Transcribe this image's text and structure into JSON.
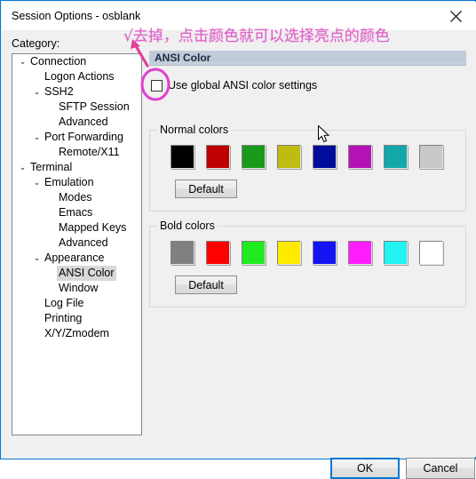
{
  "window": {
    "title": "Session Options - osblank",
    "close_icon": "close-icon"
  },
  "sidebar": {
    "label": "Category:",
    "items": [
      {
        "label": "Connection",
        "indent": 0,
        "chevron": "⌄",
        "selected": false
      },
      {
        "label": "Logon Actions",
        "indent": 1,
        "chevron": "",
        "selected": false
      },
      {
        "label": "SSH2",
        "indent": 1,
        "chevron": "⌄",
        "selected": false
      },
      {
        "label": "SFTP Session",
        "indent": 2,
        "chevron": "",
        "selected": false
      },
      {
        "label": "Advanced",
        "indent": 2,
        "chevron": "",
        "selected": false
      },
      {
        "label": "Port Forwarding",
        "indent": 1,
        "chevron": "⌄",
        "selected": false
      },
      {
        "label": "Remote/X11",
        "indent": 2,
        "chevron": "",
        "selected": false
      },
      {
        "label": "Terminal",
        "indent": 0,
        "chevron": "⌄",
        "selected": false
      },
      {
        "label": "Emulation",
        "indent": 1,
        "chevron": "⌄",
        "selected": false
      },
      {
        "label": "Modes",
        "indent": 2,
        "chevron": "",
        "selected": false
      },
      {
        "label": "Emacs",
        "indent": 2,
        "chevron": "",
        "selected": false
      },
      {
        "label": "Mapped Keys",
        "indent": 2,
        "chevron": "",
        "selected": false
      },
      {
        "label": "Advanced",
        "indent": 2,
        "chevron": "",
        "selected": false
      },
      {
        "label": "Appearance",
        "indent": 1,
        "chevron": "⌄",
        "selected": false
      },
      {
        "label": "ANSI Color",
        "indent": 2,
        "chevron": "",
        "selected": true
      },
      {
        "label": "Window",
        "indent": 2,
        "chevron": "",
        "selected": false
      },
      {
        "label": "Log File",
        "indent": 1,
        "chevron": "",
        "selected": false
      },
      {
        "label": "Printing",
        "indent": 1,
        "chevron": "",
        "selected": false
      },
      {
        "label": "X/Y/Zmodem",
        "indent": 1,
        "chevron": "",
        "selected": false
      }
    ]
  },
  "pane": {
    "header": "ANSI Color",
    "use_global_label": "Use global ANSI color settings",
    "use_global_checked": false,
    "normal": {
      "title": "Normal colors",
      "default_label": "Default",
      "colors": [
        "#000000",
        "#bd0000",
        "#1a9a1a",
        "#c0bb12",
        "#000d9a",
        "#b512b5",
        "#12a8aa",
        "#c9c9c9"
      ]
    },
    "bold": {
      "title": "Bold colors",
      "default_label": "Default",
      "colors": [
        "#808080",
        "#fd0000",
        "#20eb20",
        "#ffeb00",
        "#1414f2",
        "#fd1cfd",
        "#22f4f4",
        "#ffffff"
      ]
    }
  },
  "footer": {
    "ok_label": "OK",
    "cancel_label": "Cancel"
  },
  "annotation": {
    "text": "√去掉，点击颜色就可以选择亮点的颜色",
    "color": "#e060c8",
    "arrow_color": "#e23f9b",
    "circle_color": "#e23fd0"
  }
}
